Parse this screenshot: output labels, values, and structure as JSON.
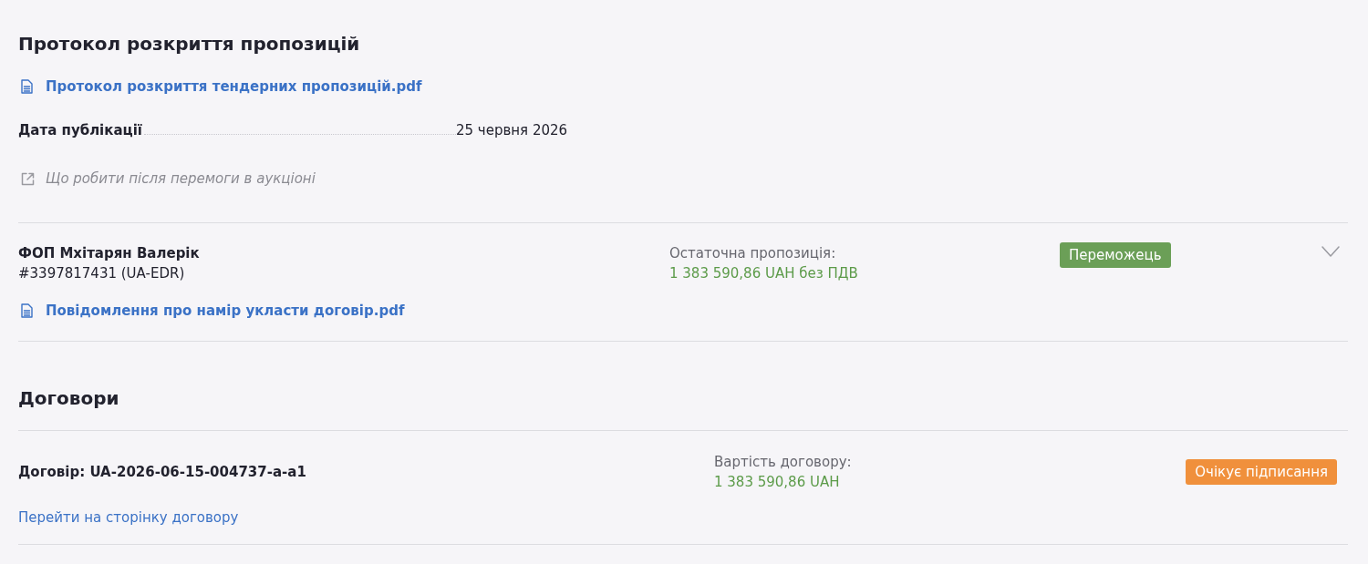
{
  "protocol": {
    "title": "Протокол розкриття пропозицій",
    "document": "Протокол розкриття тендерних пропозицій.pdf",
    "fields": [
      {
        "label": "Дата публікації",
        "value": "25 червня 2026"
      }
    ],
    "help_link": "Що робити після перемоги в аукціоні"
  },
  "bids": [
    {
      "name": "ФОП Мхітарян Валерік",
      "identifier": "#3397817431 (UA-EDR)",
      "document": "Повідомлення про намір укласти договір.pdf",
      "amount_label": "Остаточна пропозиція:",
      "amount": "1 383 590,86 UAH без ПДВ",
      "status": {
        "kind": "winner",
        "label": "Переможець"
      },
      "expanded": false
    }
  ],
  "contracts": {
    "title": "Договори",
    "items": [
      {
        "title": "Договір: UA-2026-06-15-004737-a-a1",
        "value_label": "Вартість договору:",
        "value": "1 383 590,86 UAH",
        "status": {
          "kind": "pending",
          "label": "Очікує підписання"
        },
        "link": "Перейти на сторінку договору"
      }
    ]
  }
}
